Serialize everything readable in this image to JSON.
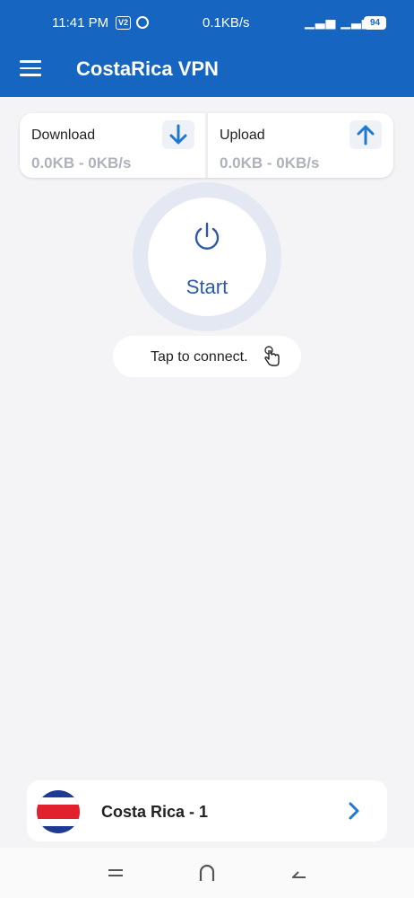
{
  "status_bar": {
    "time": "11:41 PM",
    "badge": "V2",
    "network_speed": "0.1KB/s",
    "battery": "94"
  },
  "app_bar": {
    "title": "CostaRica VPN",
    "menu_icon": "hamburger-menu-icon"
  },
  "stats": {
    "download": {
      "label": "Download",
      "value": "0.0KB - 0KB/s",
      "icon": "arrow-down-icon"
    },
    "upload": {
      "label": "Upload",
      "value": "0.0KB - 0KB/s",
      "icon": "arrow-up-icon"
    }
  },
  "power_button": {
    "label": "Start",
    "icon": "power-icon"
  },
  "hint": {
    "text": "Tap to connect.",
    "icon": "hand-pointer-icon"
  },
  "server": {
    "name": "Costa Rica - 1",
    "flag": "costa-rica-flag",
    "chevron": "chevron-right-icon"
  },
  "colors": {
    "primary": "#1665c1",
    "accent": "#2d5aa6",
    "background": "#f4f4f7",
    "muted_value": "#aeb3bb"
  },
  "system_nav": {
    "recents": "recents-icon",
    "home": "home-icon",
    "back": "back-icon"
  }
}
